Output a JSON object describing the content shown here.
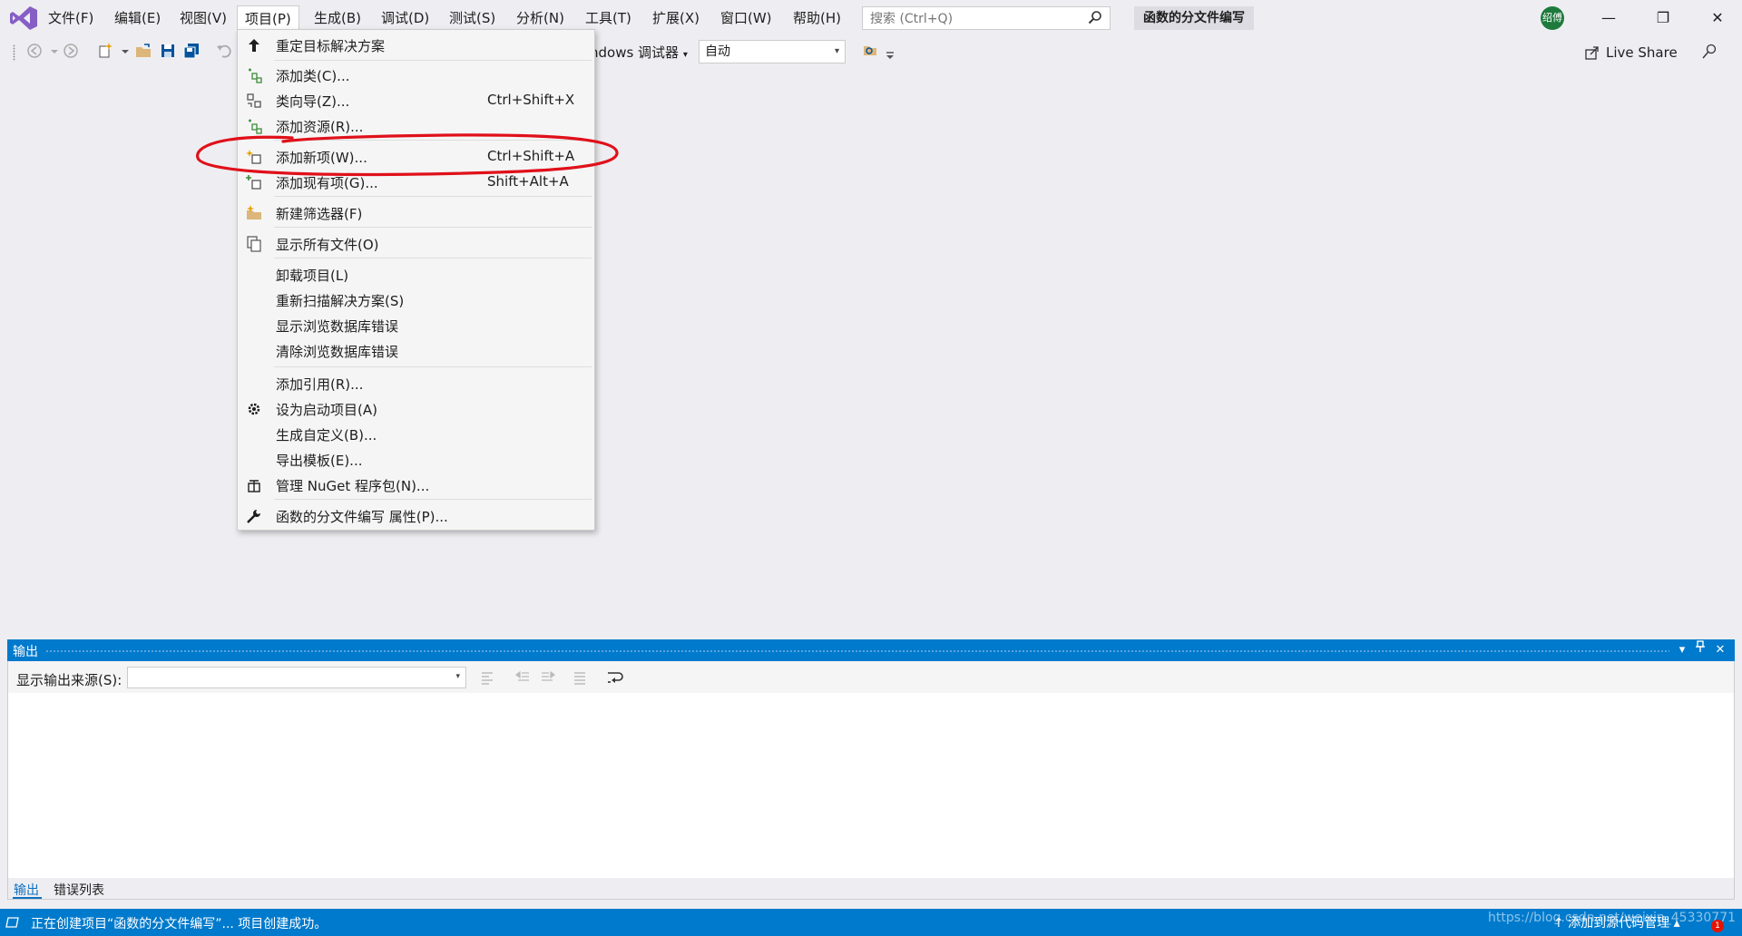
{
  "menubar": {
    "items": [
      {
        "label": "文件(F)"
      },
      {
        "label": "编辑(E)"
      },
      {
        "label": "视图(V)"
      },
      {
        "label": "项目(P)"
      },
      {
        "label": "生成(B)"
      },
      {
        "label": "调试(D)"
      },
      {
        "label": "测试(S)"
      },
      {
        "label": "分析(N)"
      },
      {
        "label": "工具(T)"
      },
      {
        "label": "扩展(X)"
      },
      {
        "label": "窗口(W)"
      },
      {
        "label": "帮助(H)"
      }
    ],
    "active_index": 3
  },
  "search": {
    "placeholder": "搜索 (Ctrl+Q)"
  },
  "solution_name": "函数的分文件编写",
  "avatar_text": "绍傅",
  "window_controls": {
    "minimize": "—",
    "restore": "❐",
    "close": "✕"
  },
  "toolbar": {
    "debugger_label": "ndows 调试器",
    "debugger_caret": "▾",
    "config_value": "自动",
    "config_caret": "▾",
    "liveshare_label": "Live Share"
  },
  "project_menu": {
    "items": [
      {
        "label": "重定目标解决方案",
        "shortcut": "",
        "icon": "arrow-up-icon"
      },
      {
        "label": "添加类(C)...",
        "shortcut": "",
        "icon": "add-class-icon"
      },
      {
        "label": "类向导(Z)...",
        "shortcut": "Ctrl+Shift+X",
        "icon": "class-wizard-icon"
      },
      {
        "label": "添加资源(R)...",
        "shortcut": "",
        "icon": "add-resource-icon"
      },
      {
        "label": "添加新项(W)...",
        "shortcut": "Ctrl+Shift+A",
        "icon": "add-new-item-icon"
      },
      {
        "label": "添加现有项(G)...",
        "shortcut": "Shift+Alt+A",
        "icon": "add-existing-item-icon"
      },
      {
        "label": "新建筛选器(F)",
        "shortcut": "",
        "icon": "new-filter-icon"
      },
      {
        "label": "显示所有文件(O)",
        "shortcut": "",
        "icon": "show-all-files-icon"
      },
      {
        "label": "卸载项目(L)",
        "shortcut": "",
        "icon": ""
      },
      {
        "label": "重新扫描解决方案(S)",
        "shortcut": "",
        "icon": ""
      },
      {
        "label": "显示浏览数据库错误",
        "shortcut": "",
        "icon": ""
      },
      {
        "label": "清除浏览数据库错误",
        "shortcut": "",
        "icon": ""
      },
      {
        "label": "添加引用(R)...",
        "shortcut": "",
        "icon": ""
      },
      {
        "label": "设为启动项目(A)",
        "shortcut": "",
        "icon": "gear-icon"
      },
      {
        "label": "生成自定义(B)...",
        "shortcut": "",
        "icon": ""
      },
      {
        "label": "导出模板(E)...",
        "shortcut": "",
        "icon": ""
      },
      {
        "label": "管理 NuGet 程序包(N)...",
        "shortcut": "",
        "icon": "nuget-icon"
      },
      {
        "label": "函数的分文件编写 属性(P)...",
        "shortcut": "",
        "icon": "wrench-icon"
      }
    ]
  },
  "output_panel": {
    "title": "输出",
    "source_label": "显示输出来源(S):",
    "source_value": "",
    "source_caret": "▾",
    "header_buttons": {
      "dropdown": "▾",
      "pin": "📌",
      "close": "✕"
    },
    "tabs": [
      {
        "label": "输出",
        "active": true
      },
      {
        "label": "错误列表",
        "active": false
      }
    ]
  },
  "statusbar": {
    "text": "正在创建项目“函数的分文件编写”... 项目创建成功。",
    "right_text": "↑ 添加到源代码管理 ▴",
    "watermark": "https://blog.csdn.net/weixin_45330771",
    "badge": "1"
  },
  "colors": {
    "accent": "#007acc",
    "annotation": "#e0101a",
    "chrome": "#eeeef2"
  }
}
